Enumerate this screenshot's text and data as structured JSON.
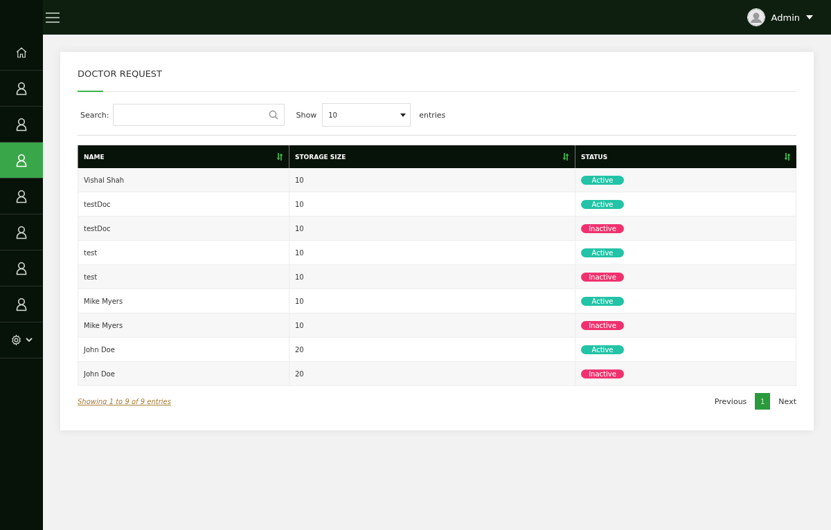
{
  "topbar": {
    "user": {
      "name": "Admin"
    }
  },
  "sidebar": {
    "items": [
      {
        "kind": "home",
        "selected": false
      },
      {
        "kind": "user",
        "selected": false
      },
      {
        "kind": "user",
        "selected": false
      },
      {
        "kind": "user",
        "selected": true
      },
      {
        "kind": "user",
        "selected": false
      },
      {
        "kind": "user",
        "selected": false
      },
      {
        "kind": "user",
        "selected": false
      },
      {
        "kind": "user",
        "selected": false
      },
      {
        "kind": "settings",
        "selected": false
      }
    ]
  },
  "card": {
    "title": "DOCTOR REQUEST",
    "search": {
      "label": "Search:"
    },
    "length": {
      "label_before": "Show",
      "value": "10",
      "label_after": "entries"
    },
    "table": {
      "columns": [
        "NAME",
        "STORAGE SIZE",
        "STATUS"
      ],
      "rows": [
        {
          "name": "Vishal Shah",
          "storage": "10",
          "status": "Active",
          "active": true
        },
        {
          "name": "testDoc",
          "storage": "10",
          "status": "Active",
          "active": true
        },
        {
          "name": "testDoc",
          "storage": "10",
          "status": "Inactive",
          "active": false
        },
        {
          "name": "test",
          "storage": "10",
          "status": "Active",
          "active": true
        },
        {
          "name": "test",
          "storage": "10",
          "status": "Inactive",
          "active": false
        },
        {
          "name": "Mike Myers",
          "storage": "10",
          "status": "Active",
          "active": true
        },
        {
          "name": "Mike Myers",
          "storage": "10",
          "status": "Inactive",
          "active": false
        },
        {
          "name": "John Doe",
          "storage": "20",
          "status": "Active",
          "active": true
        },
        {
          "name": "John Doe",
          "storage": "20",
          "status": "Inactive",
          "active": false
        }
      ]
    },
    "info": "Showing 1 to 9 of 9 entries",
    "pagination": {
      "previous": "Previous",
      "pages": [
        {
          "label": "1",
          "selected": true
        }
      ],
      "next": "Next"
    }
  }
}
